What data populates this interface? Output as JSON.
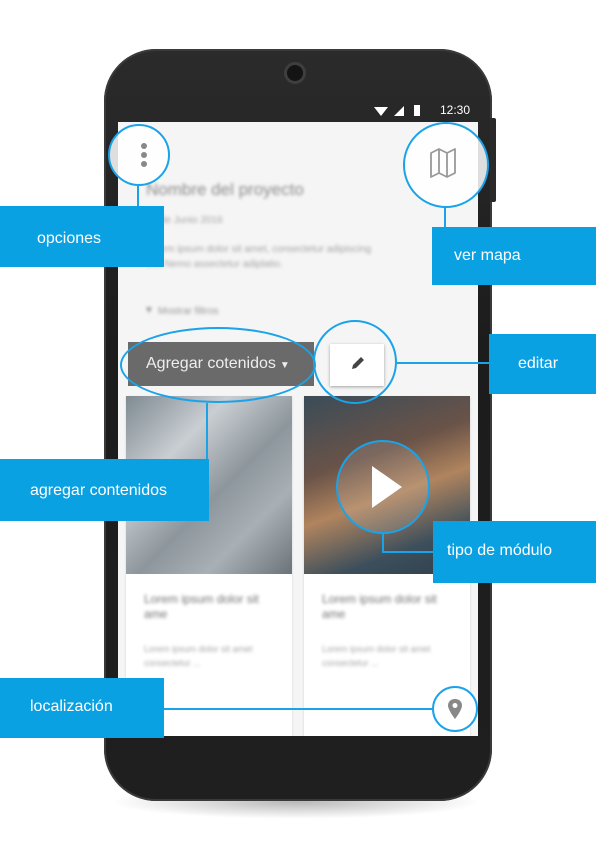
{
  "status_bar": {
    "time": "12:30"
  },
  "project": {
    "title": "Nombre del proyecto",
    "date": "12 de Junio 2016",
    "description": "Lorem ipsum dolor sit amet, consectetur adipiscing elit. Nemo assectetur adiplatio.",
    "filters_label": "Mostrar filtros"
  },
  "actions": {
    "add_contents_label": "Agregar cotenidos",
    "edit_icon": "pencil-icon",
    "options_icon": "more-vertical-icon",
    "map_icon": "map-icon",
    "play_icon": "play-icon",
    "location_icon": "map-pin-icon"
  },
  "cards": [
    {
      "title": "Lorem ipsum dolor sit ame",
      "text": "Lorem ipsum dolor sit amet consectetur ..."
    },
    {
      "title": "Lorem ipsum dolor sit ame",
      "text": "Lorem ipsum dolor sit amet consectetur ..."
    }
  ],
  "annotations": {
    "opciones": "opciones",
    "ver_mapa": "ver mapa",
    "editar": "editar",
    "agregar_contenidos": "agregar contenidos",
    "tipo_de_modulo": "tipo de módulo",
    "localizacion": "localización"
  },
  "colors": {
    "accent": "#0aa1e3",
    "phone_body": "#222222"
  }
}
